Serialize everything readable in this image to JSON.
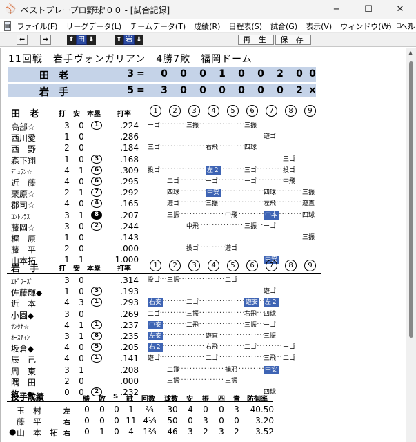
{
  "window": {
    "title": "ベストプレープロ野球'００ - [試合記録]",
    "app_icon": "baseball-app-icon",
    "minimize": "−",
    "maximize": "☐",
    "close": "✕"
  },
  "menu": {
    "items": [
      "ファイル(F)",
      "リーグデータ(L)",
      "チームデータ(T)",
      "成績(R)",
      "日程表(S)",
      "試合(G)",
      "表示(V)",
      "ウィンドウ(W)",
      "ヘルプ(H)"
    ],
    "mdi_buttons": [
      "−",
      "▫",
      "✕"
    ]
  },
  "toolbar": {
    "prev": "⬅",
    "next": "➡",
    "team1": "田",
    "team2": "岩",
    "replay": "再 生",
    "save": "保 存"
  },
  "game": {
    "title": "11回戦　岩手ヴォンガリアン　4勝7敗　福岡ドーム"
  },
  "scoreboard": [
    {
      "team": "田老",
      "total": "3",
      "eq": "=",
      "innings": [
        "0",
        "0",
        "0",
        "1",
        "0",
        "0",
        "2",
        "0",
        "0"
      ]
    },
    {
      "team": "岩手",
      "total": "5",
      "eq": "=",
      "innings": [
        "3",
        "0",
        "0",
        "0",
        "0",
        "0",
        "0",
        "2",
        "×"
      ]
    }
  ],
  "batting_headers": {
    "ab": "打",
    "h": "安",
    "hr": "本塁",
    "avg": "打率",
    "innings": [
      "1",
      "2",
      "3",
      "4",
      "5",
      "6",
      "7",
      "8",
      "9"
    ]
  },
  "tarou": {
    "team": "田老",
    "rows": [
      {
        "name": "高部☆",
        "ab": "3",
        "h": "0",
        "hr": "1",
        "avg": ".224",
        "res": [
          {
            "i": 0,
            "t": "ーゴ"
          },
          {
            "i": 2,
            "t": "三振"
          },
          {
            "i": 5,
            "t": "三振"
          }
        ]
      },
      {
        "name": "西川愛",
        "ab": "1",
        "h": "0",
        "hr": "",
        "avg": ".286",
        "res": [
          {
            "i": 6,
            "t": "遊ゴ"
          }
        ]
      },
      {
        "name": "西　野",
        "ab": "2",
        "h": "0",
        "hr": "",
        "avg": ".184",
        "res": [
          {
            "i": 0,
            "t": "三ゴ"
          },
          {
            "i": 3,
            "t": "右飛"
          },
          {
            "i": 5,
            "t": "四球"
          }
        ]
      },
      {
        "name": "森下翔",
        "ab": "1",
        "h": "0",
        "hr": "3",
        "avg": ".168",
        "res": [
          {
            "i": 7,
            "t": "三ゴ"
          }
        ]
      },
      {
        "name": "ﾃﾞｭﾗﾝ☆",
        "small": true,
        "ab": "4",
        "h": "1",
        "hr": "6",
        "avg": ".309",
        "res": [
          {
            "i": 0,
            "t": "投ゴ"
          },
          {
            "i": 3,
            "t": "左２",
            "hl": true
          },
          {
            "i": 5,
            "t": "三ゴ"
          },
          {
            "i": 7,
            "t": "投ゴ"
          }
        ]
      },
      {
        "name": "近　藤",
        "ab": "4",
        "h": "0",
        "hr": "6",
        "avg": ".295",
        "res": [
          {
            "i": 1,
            "t": "二ゴ"
          },
          {
            "i": 3,
            "t": "ーゴ"
          },
          {
            "i": 5,
            "t": "ーゴ"
          },
          {
            "i": 7,
            "t": "中飛"
          }
        ]
      },
      {
        "name": "栗原☆",
        "ab": "2",
        "h": "1",
        "hr": "7",
        "avg": ".292",
        "res": [
          {
            "i": 1,
            "t": "四球"
          },
          {
            "i": 3,
            "t": "中安",
            "hl": true
          },
          {
            "i": 6,
            "t": "四球"
          },
          {
            "i": 8,
            "t": "三振"
          }
        ]
      },
      {
        "name": "郡司☆",
        "ab": "4",
        "h": "0",
        "hr": "4",
        "avg": ".165",
        "res": [
          {
            "i": 1,
            "t": "遊ゴ"
          },
          {
            "i": 3,
            "t": "三振"
          },
          {
            "i": 6,
            "t": "左飛"
          },
          {
            "i": 8,
            "t": "遊直"
          }
        ]
      },
      {
        "name": "ｺﾝﾄﾚﾗｽ",
        "small": true,
        "ab": "3",
        "h": "1",
        "hr": "8",
        "hrFilled": true,
        "avg": ".207",
        "res": [
          {
            "i": 1,
            "t": "三振"
          },
          {
            "i": 4,
            "t": "中飛"
          },
          {
            "i": 6,
            "t": "中本",
            "hl": true
          },
          {
            "i": 8,
            "t": "四球"
          }
        ]
      },
      {
        "name": "藤岡☆",
        "ab": "3",
        "h": "0",
        "hr": "2",
        "avg": ".244",
        "res": [
          {
            "i": 2,
            "t": "中飛"
          },
          {
            "i": 5,
            "t": "三振"
          },
          {
            "i": 6,
            "t": "ーゴ"
          }
        ]
      },
      {
        "name": "梶　原",
        "ab": "1",
        "h": "0",
        "hr": "",
        "avg": ".143",
        "res": [
          {
            "i": 8,
            "t": "三振"
          }
        ]
      },
      {
        "name": "藤　平",
        "ab": "2",
        "h": "0",
        "hr": "",
        "avg": ".000",
        "res": [
          {
            "i": 2,
            "t": "投ゴ"
          },
          {
            "i": 4,
            "t": "遊ゴ"
          }
        ]
      },
      {
        "name": "山本拓",
        "ab": "1",
        "h": "1",
        "hr": "",
        "avg": "1.000",
        "res": [
          {
            "i": 6,
            "t": "中安",
            "hl": true
          }
        ]
      }
    ]
  },
  "iwate": {
    "team": "岩手",
    "rows": [
      {
        "name": "ｴﾄﾞﾜｰｽﾞ",
        "small": true,
        "ab": "3",
        "h": "0",
        "hr": "",
        "avg": ".314",
        "res": [
          {
            "i": 0,
            "t": "投ゴ"
          },
          {
            "i": 1,
            "t": "三振"
          },
          {
            "i": 4,
            "t": "二ゴ"
          }
        ]
      },
      {
        "name": "佐藤輝◆",
        "ab": "1",
        "h": "0",
        "hr": "3",
        "avg": ".193",
        "res": [
          {
            "i": 6,
            "t": "遊ゴ"
          }
        ]
      },
      {
        "name": "近　本",
        "ab": "4",
        "h": "3",
        "hr": "1",
        "avg": ".293",
        "res": [
          {
            "i": 0,
            "t": "右安",
            "hl": true
          },
          {
            "i": 2,
            "t": "二ゴ"
          },
          {
            "i": 5,
            "t": "遊安",
            "hl": true
          },
          {
            "i": 6,
            "t": "左２",
            "hl": true
          }
        ]
      },
      {
        "name": "小園◆",
        "ab": "3",
        "h": "0",
        "hr": "",
        "avg": ".269",
        "res": [
          {
            "i": 0,
            "t": "二ゴ"
          },
          {
            "i": 2,
            "t": "三振"
          },
          {
            "i": 5,
            "t": "右飛"
          },
          {
            "i": 6,
            "t": "四球"
          }
        ]
      },
      {
        "name": "ｻﾝﾀﾅ☆",
        "small": true,
        "ab": "4",
        "h": "1",
        "hr": "1",
        "avg": ".237",
        "res": [
          {
            "i": 0,
            "t": "中安",
            "hl": true
          },
          {
            "i": 2,
            "t": "二飛"
          },
          {
            "i": 5,
            "t": "三振"
          },
          {
            "i": 6,
            "t": "ーゴ"
          }
        ]
      },
      {
        "name": "ｵｰｽﾃｨﾝ",
        "small": true,
        "ab": "3",
        "h": "1",
        "hr": "8",
        "avg": ".235",
        "res": [
          {
            "i": 0,
            "t": "左安",
            "hl": true
          },
          {
            "i": 3,
            "t": "遊直"
          },
          {
            "i": 6,
            "t": "三振"
          }
        ]
      },
      {
        "name": "坂倉◆",
        "ab": "4",
        "h": "0",
        "hr": "5",
        "avg": ".205",
        "res": [
          {
            "i": 0,
            "t": "右２",
            "hl": true
          },
          {
            "i": 3,
            "t": "右飛"
          },
          {
            "i": 5,
            "t": "二ゴ"
          },
          {
            "i": 7,
            "t": "ーゴ"
          }
        ]
      },
      {
        "name": "辰　己",
        "ab": "4",
        "h": "0",
        "hr": "1",
        "avg": ".141",
        "res": [
          {
            "i": 0,
            "t": "遊ゴ"
          },
          {
            "i": 3,
            "t": "二ゴ"
          },
          {
            "i": 6,
            "t": "三飛"
          },
          {
            "i": 7,
            "t": "二ゴ"
          }
        ]
      },
      {
        "name": "周　東",
        "ab": "3",
        "h": "1",
        "hr": "",
        "avg": ".208",
        "res": [
          {
            "i": 1,
            "t": "二飛"
          },
          {
            "i": 4,
            "t": "捕邪"
          },
          {
            "i": 6,
            "t": "中安",
            "hl": true
          }
        ]
      },
      {
        "name": "隅　田",
        "ab": "2",
        "h": "0",
        "hr": "",
        "avg": ".000",
        "res": [
          {
            "i": 1,
            "t": "三振"
          },
          {
            "i": 4,
            "t": "三振"
          }
        ]
      },
      {
        "name": "牧☆◆",
        "ab": "0",
        "h": "0",
        "hr": "2",
        "avg": ".232",
        "res": [
          {
            "i": 6,
            "t": "四球"
          }
        ]
      }
    ]
  },
  "pitching": {
    "title": "投手成績",
    "headers": [
      "勝",
      "敗",
      "S",
      "試",
      "回数",
      "球数",
      "安",
      "振",
      "四",
      "責",
      "防御率"
    ],
    "rows": [
      {
        "bullet": "",
        "name": "玉村",
        "hand": "左",
        "w": "0",
        "l": "0",
        "s": "0",
        "g": "1",
        "ip": "⅔",
        "np": "30",
        "h": "4",
        "so": "0",
        "bb": "0",
        "er": "3",
        "era": "40.50"
      },
      {
        "bullet": "",
        "name": "藤平",
        "hand": "右",
        "w": "0",
        "l": "0",
        "s": "0",
        "g": "11",
        "ip": "4⅓",
        "np": "50",
        "h": "0",
        "so": "3",
        "bb": "0",
        "er": "0",
        "era": "3.20"
      },
      {
        "bullet": "●",
        "name": "山本拓",
        "hand": "右",
        "w": "0",
        "l": "1",
        "s": "0",
        "g": "4",
        "ip": "1⅔",
        "np": "46",
        "h": "3",
        "so": "2",
        "bb": "3",
        "er": "2",
        "era": "3.52"
      }
    ]
  }
}
